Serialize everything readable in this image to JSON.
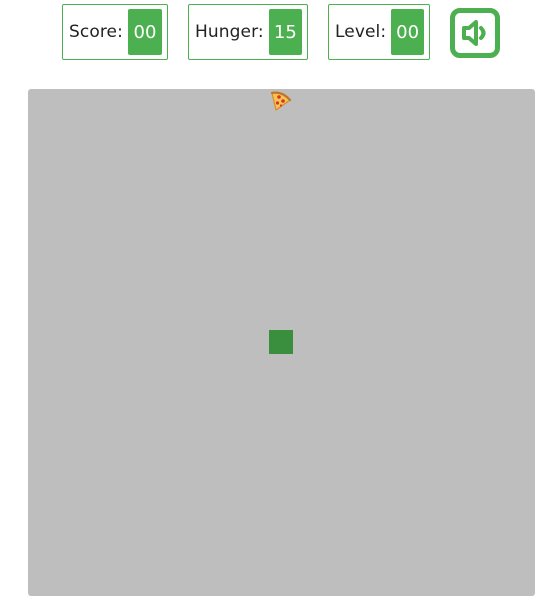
{
  "hud": {
    "score": {
      "label": "Score:",
      "value": "00"
    },
    "hunger": {
      "label": "Hunger:",
      "value": "15"
    },
    "level": {
      "label": "Level:",
      "value": "00"
    }
  },
  "sound_button": {
    "icon": "speaker-icon"
  },
  "board": {
    "food": {
      "icon": "pizza-icon"
    },
    "snake": {
      "segments": 1
    }
  },
  "colors": {
    "accent": "#4caf50",
    "board": "#bebebe",
    "snake": "#3a8f3e"
  }
}
